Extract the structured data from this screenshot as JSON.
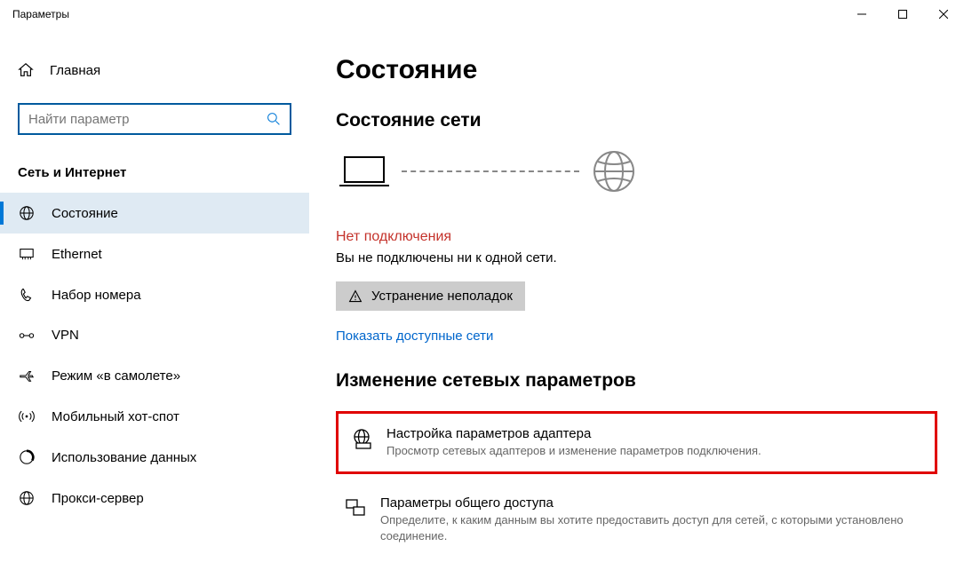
{
  "window": {
    "title": "Параметры"
  },
  "sidebar": {
    "home": "Главная",
    "search_placeholder": "Найти параметр",
    "category": "Сеть и Интернет",
    "items": [
      {
        "label": "Состояние"
      },
      {
        "label": "Ethernet"
      },
      {
        "label": "Набор номера"
      },
      {
        "label": "VPN"
      },
      {
        "label": "Режим «в самолете»"
      },
      {
        "label": "Мобильный хот-спот"
      },
      {
        "label": "Использование данных"
      },
      {
        "label": "Прокси-сервер"
      }
    ]
  },
  "main": {
    "title": "Состояние",
    "section": "Состояние сети",
    "error_title": "Нет подключения",
    "error_desc": "Вы не подключены ни к одной сети.",
    "troubleshoot": "Устранение неполадок",
    "show_networks": "Показать доступные сети",
    "change_section": "Изменение сетевых параметров",
    "options": [
      {
        "title": "Настройка параметров адаптера",
        "desc": "Просмотр сетевых адаптеров и изменение параметров подключения."
      },
      {
        "title": "Параметры общего доступа",
        "desc": "Определите, к каким данным вы хотите предоставить доступ для сетей, с которыми установлено соединение."
      }
    ]
  }
}
